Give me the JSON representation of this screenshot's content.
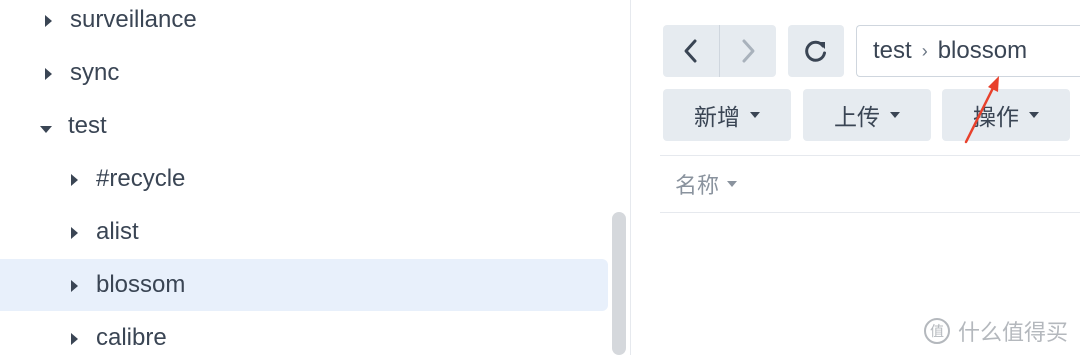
{
  "tree": {
    "items": [
      {
        "label": "surveillance",
        "expanded": false,
        "level": 0
      },
      {
        "label": "sync",
        "expanded": false,
        "level": 0
      },
      {
        "label": "test",
        "expanded": true,
        "level": 0
      },
      {
        "label": "#recycle",
        "expanded": false,
        "level": 1
      },
      {
        "label": "alist",
        "expanded": false,
        "level": 1
      },
      {
        "label": "blossom",
        "expanded": false,
        "level": 1,
        "selected": true
      },
      {
        "label": "calibre",
        "expanded": false,
        "level": 1
      }
    ]
  },
  "toolbar": {
    "back_icon": "chevron-left-icon",
    "forward_icon": "chevron-right-icon",
    "refresh_icon": "refresh-icon",
    "path": [
      "test",
      "blossom"
    ],
    "path_separator": "›",
    "create_label": "新增",
    "upload_label": "上传",
    "action_label": "操作"
  },
  "file_list": {
    "name_header": "名称"
  },
  "watermark": {
    "text": "什么值得买",
    "icon": "值"
  },
  "colors": {
    "selected_bg": "#e8f0fb",
    "button_bg": "#e6ebf0",
    "text": "#3a4554",
    "annotation_arrow": "#e8412c"
  }
}
